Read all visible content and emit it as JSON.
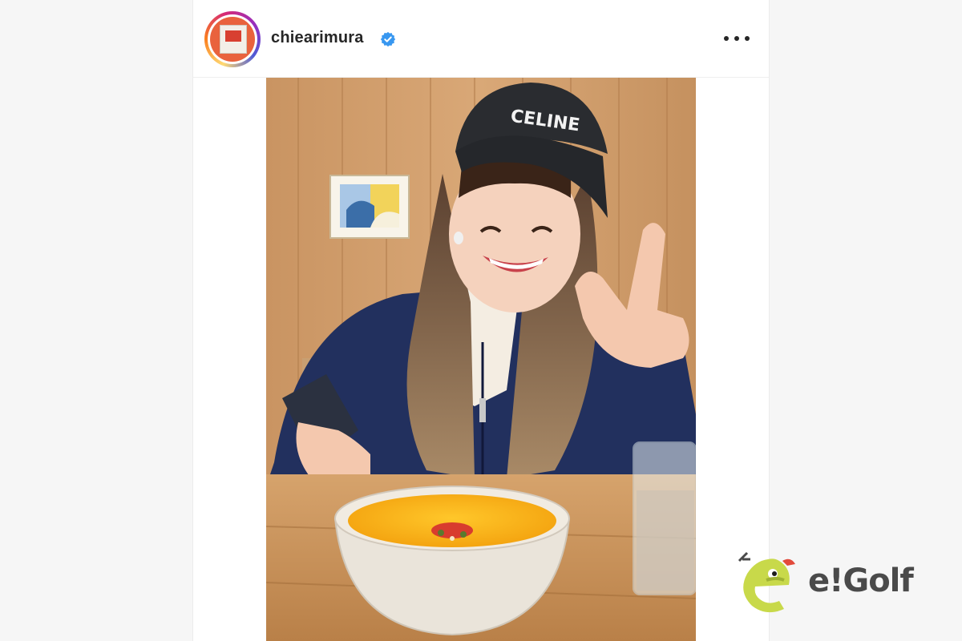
{
  "post": {
    "username": "chiearimura",
    "verified_icon": "verified-badge-icon",
    "more_icon": "more-options-icon"
  },
  "photo": {
    "cap_text": "CELINE"
  },
  "logo": {
    "text": "e!Golf"
  },
  "colors": {
    "verified_blue": "#3897f0",
    "logo_green": "#c8d94a",
    "logo_text": "#4a4a4a"
  }
}
